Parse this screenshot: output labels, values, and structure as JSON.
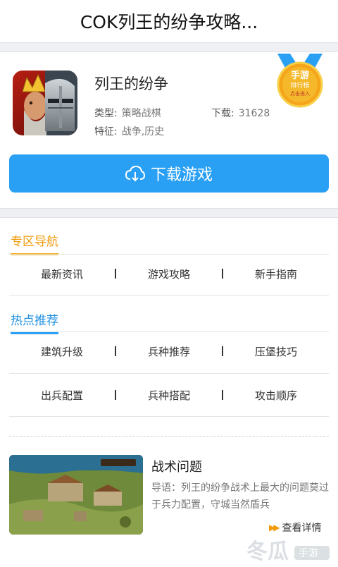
{
  "header": {
    "title": "COK列王的纷争攻略..."
  },
  "game": {
    "name": "列王的纷争",
    "type_label": "类型:",
    "type_value": "策略战棋",
    "downloads_label": "下载:",
    "downloads_value": "31628",
    "feature_label": "特征:",
    "feature_value": "战争,历史",
    "icon": "game-king-icon"
  },
  "badge": {
    "line1": "手游",
    "line2": "排行榜",
    "line3": "点击进入"
  },
  "download_button": {
    "label": "下载游戏",
    "icon": "cloud-download-icon"
  },
  "zone_nav": {
    "title": "专区导航",
    "items": [
      "最新资讯",
      "游戏攻略",
      "新手指南"
    ]
  },
  "hot": {
    "title": "热点推荐",
    "rows": [
      [
        "建筑升级",
        "兵种推荐",
        "压堡技巧"
      ],
      [
        "出兵配置",
        "兵种搭配",
        "攻击顺序"
      ]
    ]
  },
  "article": {
    "title": "战术问题",
    "desc": "导语：列王的纷争战术上最大的问题莫过于兵力配置，守城当然盾兵",
    "more": "查看详情"
  },
  "watermark": {
    "brand": "冬瓜",
    "sub": "手游"
  },
  "colors": {
    "accent_blue": "#2aa0f5",
    "accent_orange": "#f29a0a"
  }
}
